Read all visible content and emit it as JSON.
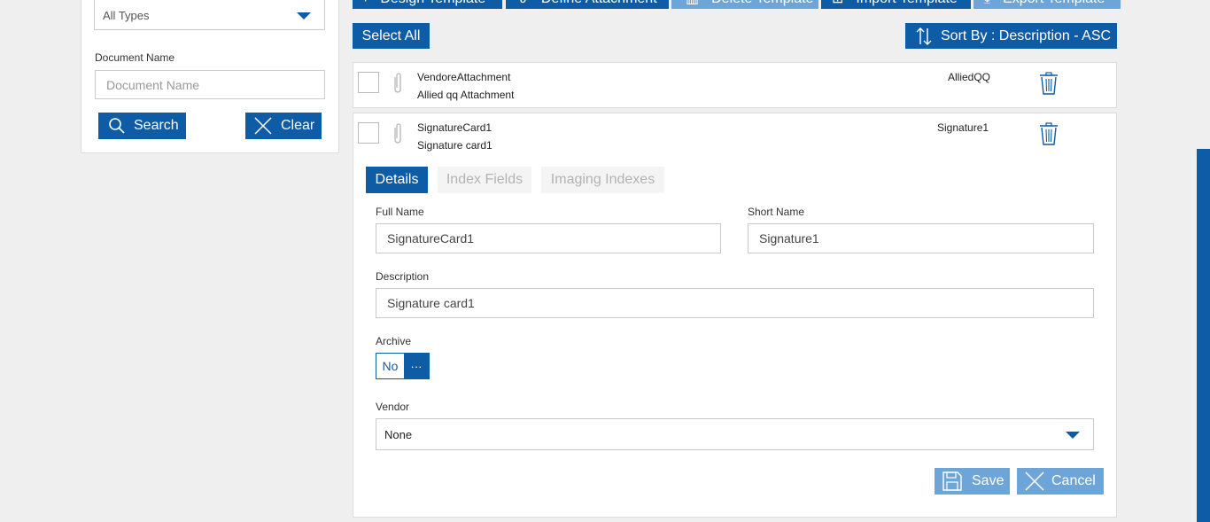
{
  "toolbar": {
    "design_template": "Design Template",
    "define_attachment": "Define Attachment",
    "delete_template": "Delete Template",
    "import_template": "Import Template",
    "export_template": "Export Template",
    "select_all": "Select All",
    "sort_by": "Sort By : Description - ASC"
  },
  "filter": {
    "type_value": "All Types",
    "doc_name_label": "Document Name",
    "doc_name_placeholder": "Document Name",
    "search_label": "Search",
    "clear_label": "Clear"
  },
  "rows": [
    {
      "name": "VendoreAttachment",
      "description": "Allied qq Attachment",
      "short_name": "AlliedQQ"
    },
    {
      "name": "SignatureCard1",
      "description": "Signature card1",
      "short_name": "Signature1"
    }
  ],
  "detail": {
    "tabs": [
      "Details",
      "Index Fields",
      "Imaging Indexes"
    ],
    "full_name_label": "Full Name",
    "full_name_value": "SignatureCard1",
    "short_name_label": "Short Name",
    "short_name_value": "Signature1",
    "description_label": "Description",
    "description_value": "Signature card1",
    "archive_label": "Archive",
    "archive_value": "No",
    "archive_more": "···",
    "vendor_label": "Vendor",
    "vendor_value": "None",
    "save_label": "Save",
    "cancel_label": "Cancel"
  },
  "colors": {
    "primary": "#0f5ca6",
    "disabled": "#6da5d8"
  }
}
